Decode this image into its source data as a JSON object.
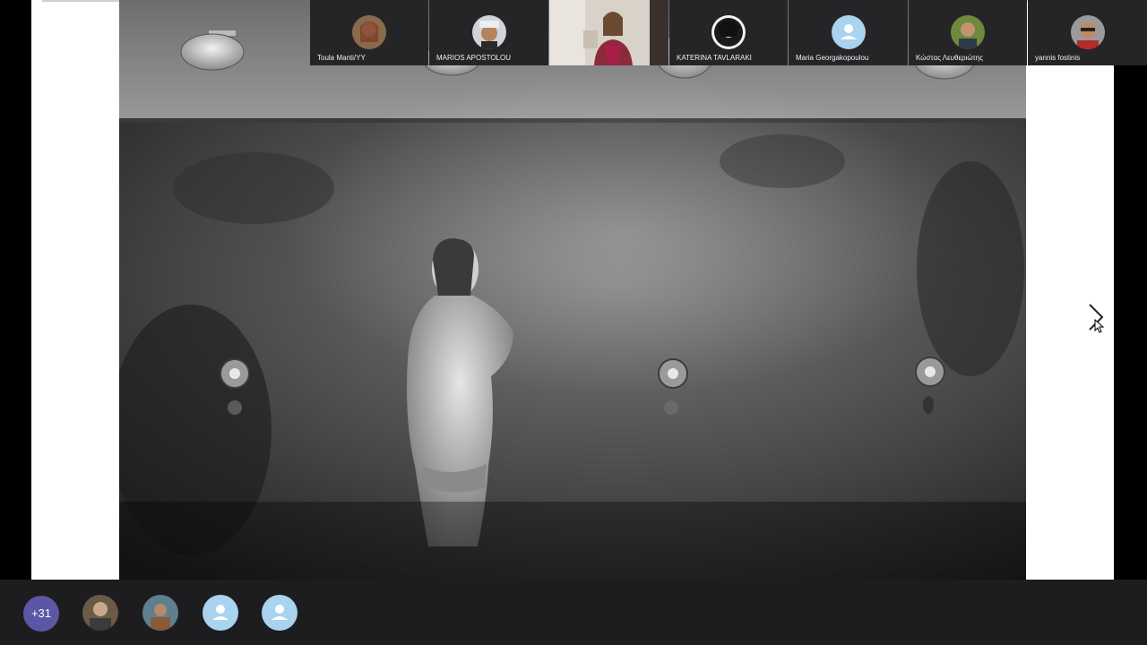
{
  "participants": {
    "overflow_count": "+31",
    "named": [
      {
        "name": "Toula Manti/YY",
        "icon": "photo-avatar"
      },
      {
        "name": "MARIOS APOSTOLOU",
        "icon": "photo-avatar"
      },
      {
        "name": "",
        "icon": "video-feed"
      },
      {
        "name": "KATERINA TAVLARAKI",
        "icon": "photo-avatar"
      },
      {
        "name": "Maria Georgakopoulou",
        "icon": "person-icon"
      },
      {
        "name": "Κώστας Λευθεριώτης",
        "icon": "photo-avatar"
      },
      {
        "name": "yannis fostinis",
        "icon": "photo-avatar"
      }
    ]
  },
  "colors": {
    "strip_background": "#1d1d1f",
    "overflow_badge": "#5b57a6",
    "generic_avatar": "#a9d3ef"
  }
}
